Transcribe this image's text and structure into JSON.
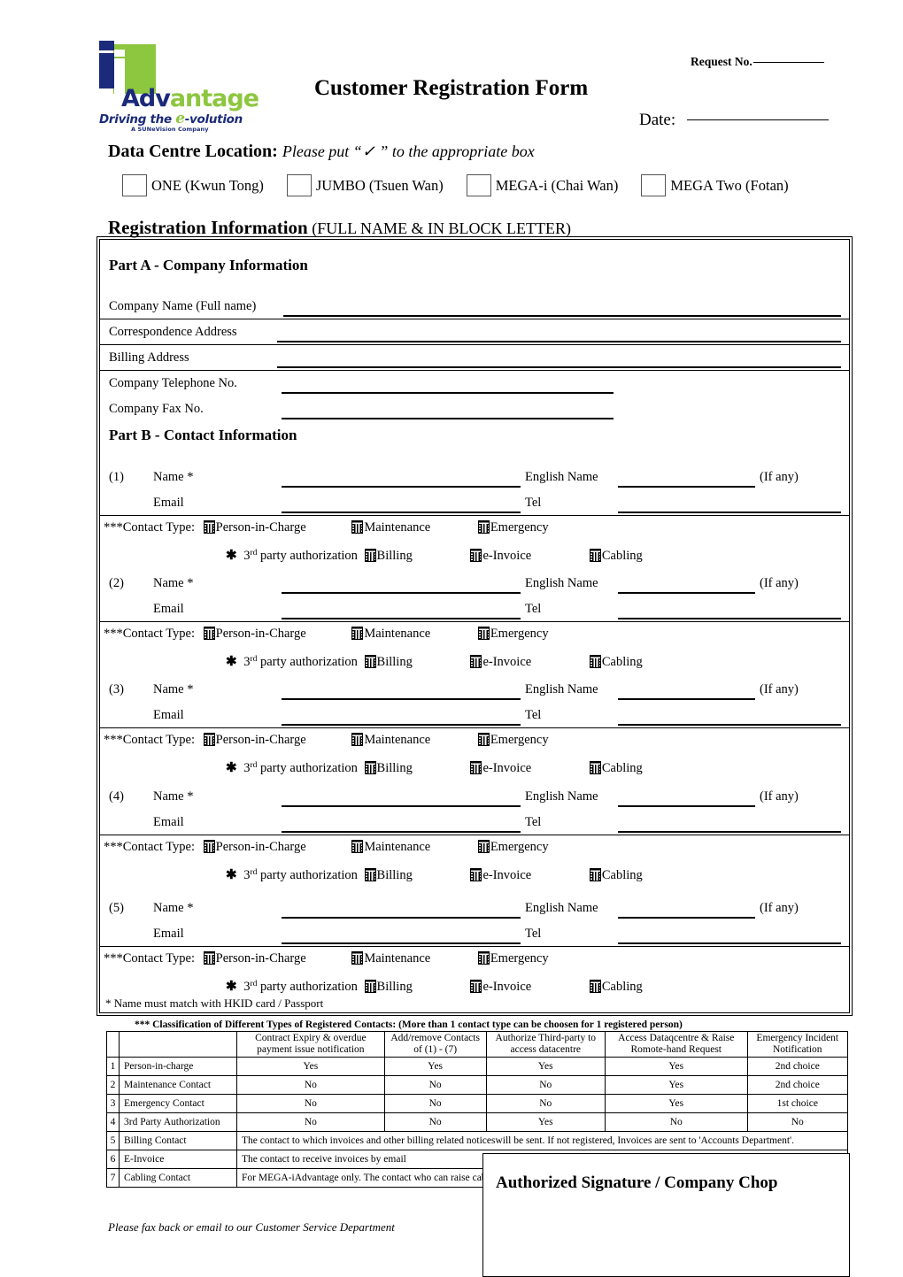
{
  "header": {
    "title": "Customer Registration Form",
    "request_no_label": "Request No.",
    "date_label": "Date:",
    "logo": {
      "word_1": "Adv",
      "word_2": "antage",
      "tagline_1": "Driving the ",
      "tagline_e": "e",
      "tagline_2": "-volution",
      "subtag": "A SUNeVision Company",
      "brand_blue": "#1B2A7A",
      "brand_green": "#8DC63F"
    }
  },
  "data_centre": {
    "label": "Data Centre Location:",
    "hint": "Please put “✓ ” to the appropriate box",
    "options": [
      "ONE (Kwun Tong)",
      "JUMBO (Tsuen Wan)",
      "MEGA-i (Chai Wan)",
      "MEGA Two (Fotan)"
    ]
  },
  "registration": {
    "heading_bold": "Registration Information",
    "heading_plain": " (FULL NAME & IN BLOCK LETTER)",
    "part_a_title": "Part A - Company Information",
    "part_b_title": "Part B - Contact Information",
    "company_fields": [
      "Company Name  (Full  name)",
      "Correspondence Address",
      "Billing Address",
      "Company  Telephone No.",
      "Company Fax No."
    ],
    "contact_labels": {
      "name": "Name *",
      "email": "Email",
      "english_name": "English Name",
      "if_any": "(If any)",
      "tel": "Tel",
      "contact_type": "***Contact Type:",
      "third_party": "party authorization",
      "third_party_ord_num": "3",
      "third_party_ord_sup": "rd",
      "types_row1": [
        "Person-in-Charge",
        "Maintenance",
        "Emergency"
      ],
      "types_row2": [
        "Billing",
        "e-Invoice",
        "Cabling"
      ]
    },
    "contacts": [
      {
        "index": "(1)"
      },
      {
        "index": "(2)"
      },
      {
        "index": "(3)"
      },
      {
        "index": "(4)"
      },
      {
        "index": "(5)"
      }
    ],
    "name_footnote": "*   Name must match with HKID card / Passport"
  },
  "classification": {
    "note": "*** Classification of Different Types of Registered Contacts: (More than 1 contact type can be choosen for 1 registered person)",
    "headers": [
      "",
      "",
      "Contract Expiry & overdue payment issue notification",
      "Add/remove Contacts of (1) - (7)",
      "Authorize Third-party to access datacentre",
      "Access Dataqcentre & Raise Romote-hand Request",
      "Emergency Incident Notification"
    ],
    "rows": [
      {
        "num": "1",
        "name": "Person-in-charge",
        "cells": [
          "Yes",
          "Yes",
          "Yes",
          "Yes",
          "2nd choice"
        ]
      },
      {
        "num": "2",
        "name": "Maintenance Contact",
        "cells": [
          "No",
          "No",
          "No",
          "Yes",
          "2nd choice"
        ]
      },
      {
        "num": "3",
        "name": "Emergency Contact",
        "cells": [
          "No",
          "No",
          "No",
          "Yes",
          "1st choice"
        ]
      },
      {
        "num": "4",
        "name": "3rd Party Authorization",
        "cells": [
          "No",
          "No",
          "Yes",
          "No",
          "No"
        ]
      }
    ],
    "desc_rows": [
      {
        "num": "5",
        "name": "Billing Contact",
        "desc": "The contact to which invoices and other billing related noticeswill be sent.  If not registered, Invoices are sent to 'Accounts Department'."
      },
      {
        "num": "6",
        "name": "E-Invoice",
        "desc": "The contact to receive invoices by email"
      },
      {
        "num": "7",
        "name": "Cabling Contact",
        "desc": "For MEGA-iAdvantage only.  The contact who can raise cabling order, and receive cabling notices, eg A-end connects to B-End."
      }
    ]
  },
  "footer": {
    "fax_note": "Please fax back or email  to our Customer Service Department",
    "signature_label": "Authorized Signature / Company Chop"
  }
}
